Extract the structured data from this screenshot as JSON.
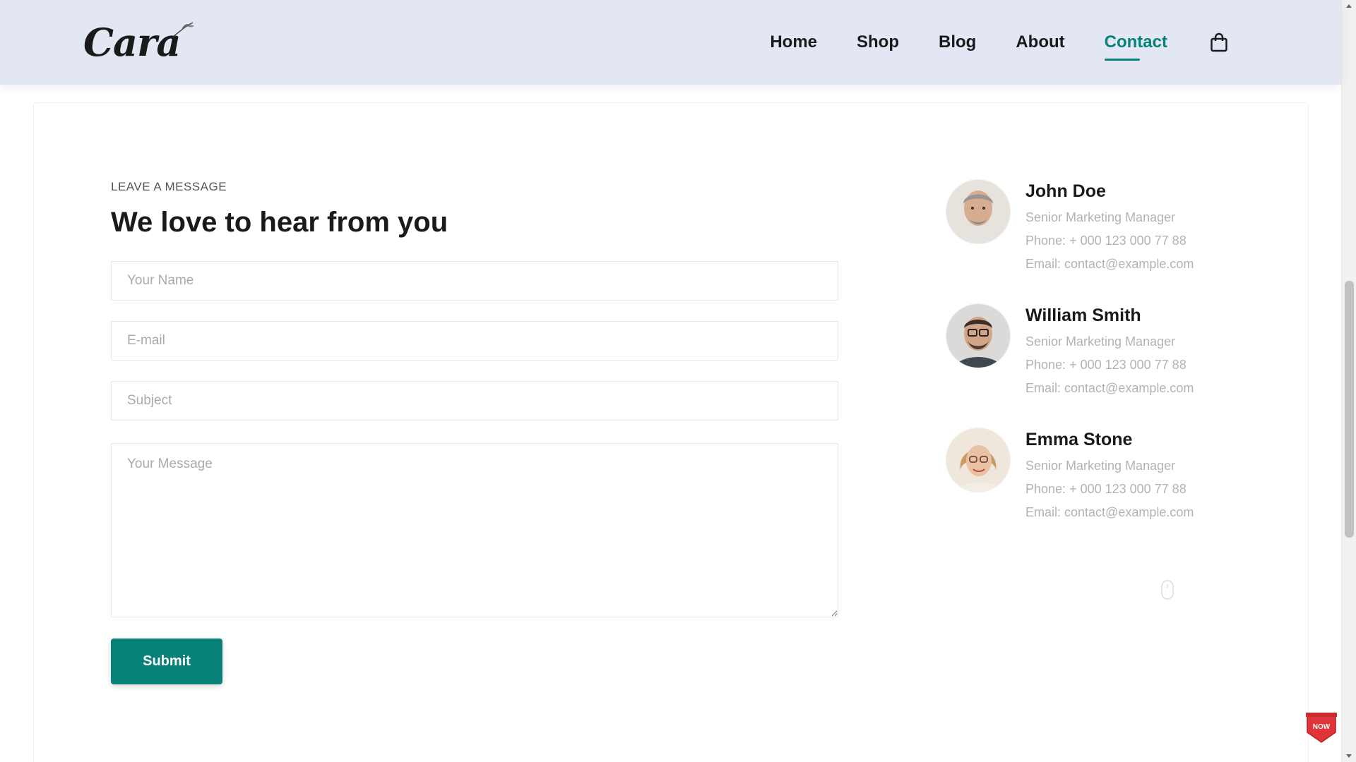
{
  "header": {
    "logo": "Cara",
    "nav": [
      {
        "label": "Home",
        "active": false
      },
      {
        "label": "Shop",
        "active": false
      },
      {
        "label": "Blog",
        "active": false
      },
      {
        "label": "About",
        "active": false
      },
      {
        "label": "Contact",
        "active": true
      }
    ],
    "cart_icon": "shopping-bag-icon"
  },
  "form": {
    "eyebrow": "LEAVE A MESSAGE",
    "title": "We love to hear from you",
    "name_placeholder": "Your Name",
    "email_placeholder": "E-mail",
    "subject_placeholder": "Subject",
    "message_placeholder": "Your Message",
    "submit_label": "Submit"
  },
  "contacts": [
    {
      "name": "John Doe",
      "role": "Senior Marketing Manager",
      "phone": "Phone: + 000 123 000 77 88",
      "email": "Email: contact@example.com"
    },
    {
      "name": "William Smith",
      "role": "Senior Marketing Manager",
      "phone": "Phone: + 000 123 000 77 88",
      "email": "Email: contact@example.com"
    },
    {
      "name": "Emma Stone",
      "role": "Senior Marketing Manager",
      "phone": "Phone: + 000 123 000 77 88",
      "email": "Email: contact@example.com"
    }
  ],
  "badge": {
    "text": "NOW"
  },
  "colors": {
    "accent": "#088178",
    "header_bg": "#e3e6f3",
    "badge_red": "#e0343a"
  }
}
